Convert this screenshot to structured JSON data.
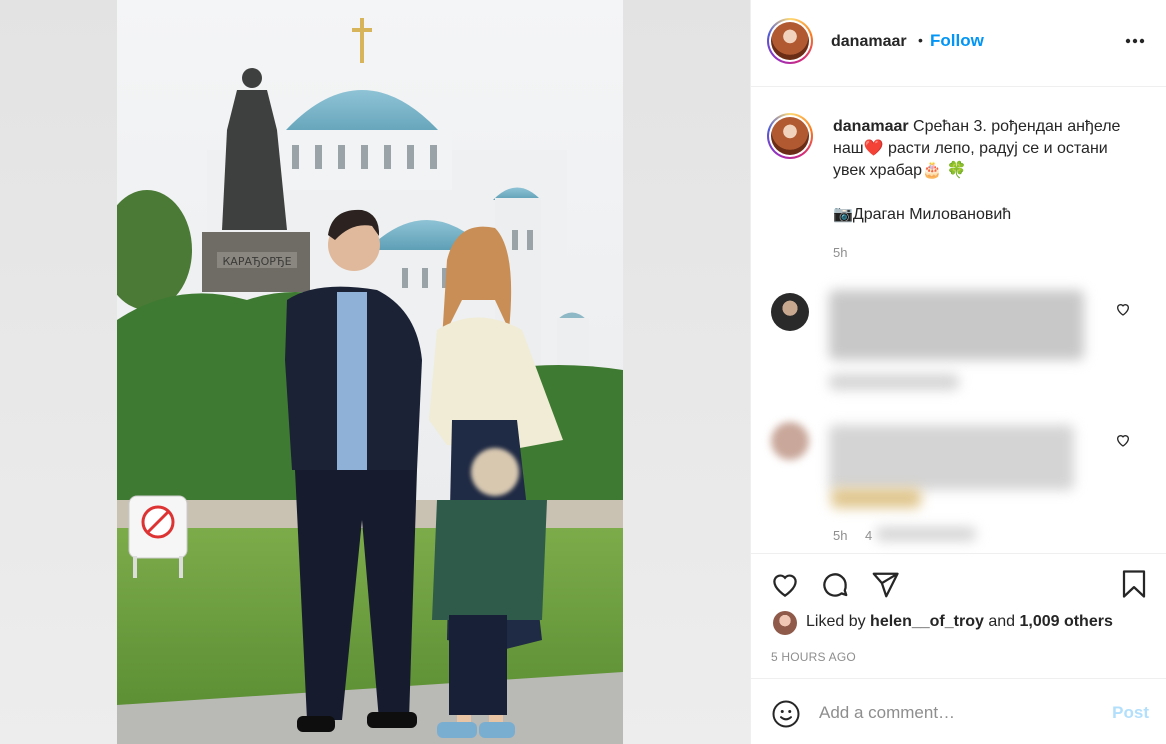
{
  "header": {
    "username": "danamaar",
    "separator": "•",
    "follow_label": "Follow",
    "more_label": "•••"
  },
  "caption": {
    "username": "danamaar",
    "line1": "Срећан 3. рођендан анђеле наш",
    "line1_emoji": "❤️",
    "line2": " расти лепо, радуј се и остани увек храбар",
    "emoji_cake": "🎂",
    "emoji_clover": "🍀",
    "credit_icon": "📷",
    "credit": "Драган Миловановић",
    "time": "5h"
  },
  "comments": [
    {
      "time": "5h",
      "extra": "4"
    }
  ],
  "icons": {
    "like": "heart-icon",
    "comment": "comment-icon",
    "share": "share-icon",
    "save": "bookmark-icon",
    "emoji": "emoji-icon",
    "more": "more-icon"
  },
  "likes": {
    "prefix": "Liked by",
    "user": "helen__of_troy",
    "and": "and",
    "others": "1,009 others"
  },
  "timestamp": "5 HOURS AGO",
  "comment_box": {
    "placeholder": "Add a comment…",
    "post_label": "Post"
  },
  "photo_sign": "КАРАЂОРЂЕ",
  "colors": {
    "accent": "#0095f6",
    "post_disabled": "#b2dffc",
    "heart": "#ed4956"
  }
}
